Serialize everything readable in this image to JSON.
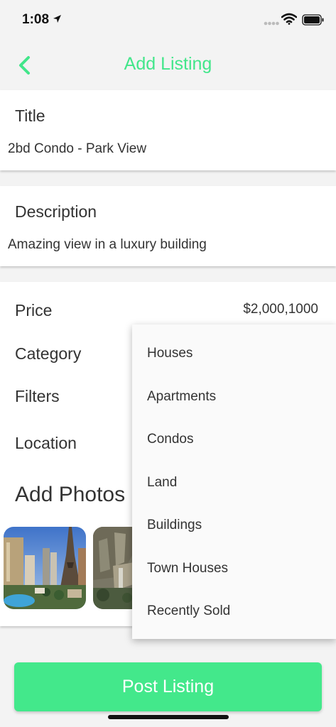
{
  "status_bar": {
    "time": "1:08"
  },
  "nav": {
    "title": "Add Listing",
    "back_icon": "chevron-left-icon",
    "accent": "#42e68a"
  },
  "title_card": {
    "label": "Title",
    "value": "2bd Condo - Park View"
  },
  "description_card": {
    "label": "Description",
    "value": "Amazing view in a luxury building"
  },
  "details": {
    "price_label": "Price",
    "price_value": "$2,000,1000",
    "category_label": "Category",
    "filters_label": "Filters",
    "location_label": "Location",
    "photos_heading": "Add Photos"
  },
  "category_dropdown": {
    "options": [
      "Houses",
      "Apartments",
      "Condos",
      "Land",
      "Buildings",
      "Town Houses",
      "Recently Sold"
    ]
  },
  "post_button": {
    "label": "Post Listing",
    "color": "#43e88b"
  }
}
